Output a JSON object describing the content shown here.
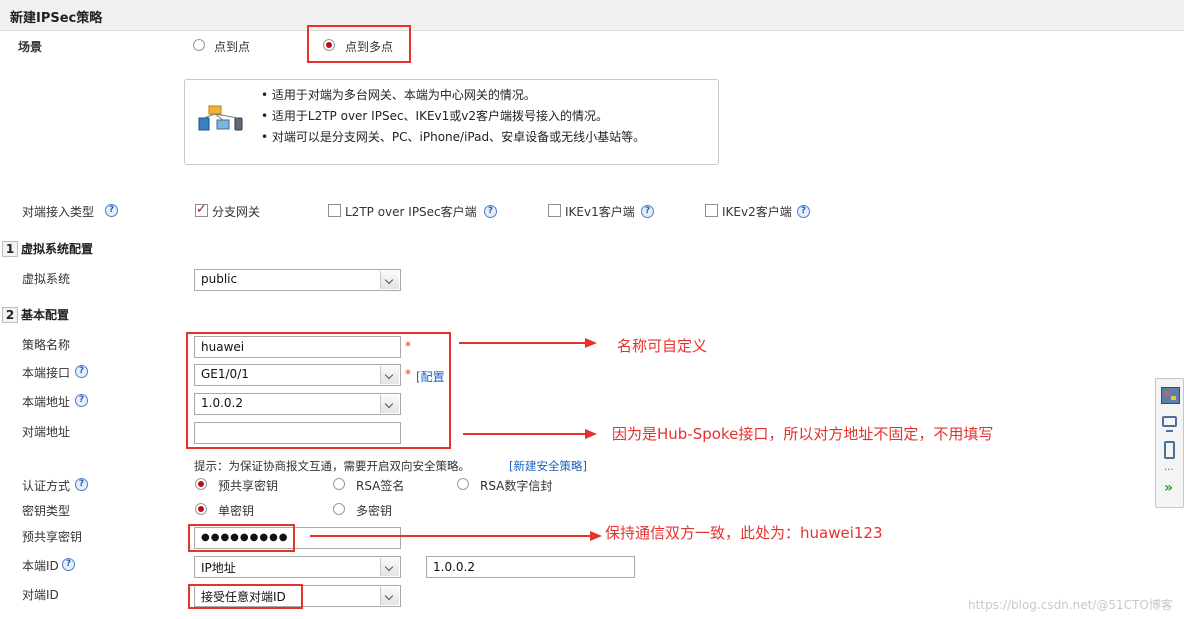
{
  "page": {
    "title": "新建IPSec策略"
  },
  "scene": {
    "label": "场景",
    "options": [
      "点到点",
      "点到多点"
    ],
    "selected": 1,
    "info": [
      "适用于对端为多台网关、本端为中心网关的情况。",
      "适用于L2TP over IPSec、IKEv1或v2客户端拨号接入的情况。",
      "对端可以是分支网关、PC、iPhone/iPad、安卓设备或无线小基站等。"
    ]
  },
  "peer_access": {
    "label": "对端接入类型",
    "options": [
      {
        "label": "分支网关",
        "checked": true
      },
      {
        "label": "L2TP over IPSec客户端",
        "checked": false
      },
      {
        "label": "IKEv1客户端",
        "checked": false
      },
      {
        "label": "IKEv2客户端",
        "checked": false
      }
    ]
  },
  "section1": {
    "num": "1",
    "title": "虚拟系统配置"
  },
  "vsys": {
    "label": "虚拟系统",
    "value": "public"
  },
  "section2": {
    "num": "2",
    "title": "基本配置"
  },
  "policy_name": {
    "label": "策略名称",
    "value": "huawei",
    "required": "*"
  },
  "local_interface": {
    "label": "本端接口",
    "value": "GE1/0/1",
    "required": "*",
    "link": "[配置"
  },
  "local_address": {
    "label": "本端地址",
    "value": "1.0.0.2"
  },
  "peer_address": {
    "label": "对端地址",
    "value": ""
  },
  "tip": {
    "text": "提示：为保证协商报文互通，需要开启双向安全策略。",
    "link": "[新建安全策略]"
  },
  "auth": {
    "label": "认证方式",
    "options": [
      "预共享密钥",
      "RSA签名",
      "RSA数字信封"
    ],
    "selected": 0
  },
  "key_type": {
    "label": "密钥类型",
    "options": [
      "单密钥",
      "多密钥"
    ],
    "selected": 0
  },
  "psk": {
    "label": "预共享密钥",
    "value": "●●●●●●●●●"
  },
  "local_id": {
    "label": "本端ID",
    "type": "IP地址",
    "value": "1.0.0.2"
  },
  "peer_id": {
    "label": "对端ID",
    "value": "接受任意对端ID"
  },
  "annotations": {
    "a1": "名称可自定义",
    "a2": "因为是Hub-Spoke接口，所以对方地址不固定，不用填写",
    "a3": "保持通信双方一致，此处为：huawei123"
  },
  "help_glyph": "?",
  "side_panel": {
    "icons": [
      "grid-icon",
      "monitor-icon",
      "phone-icon",
      "more-icon",
      "expand-icon"
    ],
    "more": "···",
    "expand": "»"
  },
  "watermark": "https://blog.csdn.net/@51CTO博客",
  "colors": {
    "accent_red": "#e5322d",
    "radio_red": "#b4121b",
    "link_blue": "#1b62c0"
  }
}
